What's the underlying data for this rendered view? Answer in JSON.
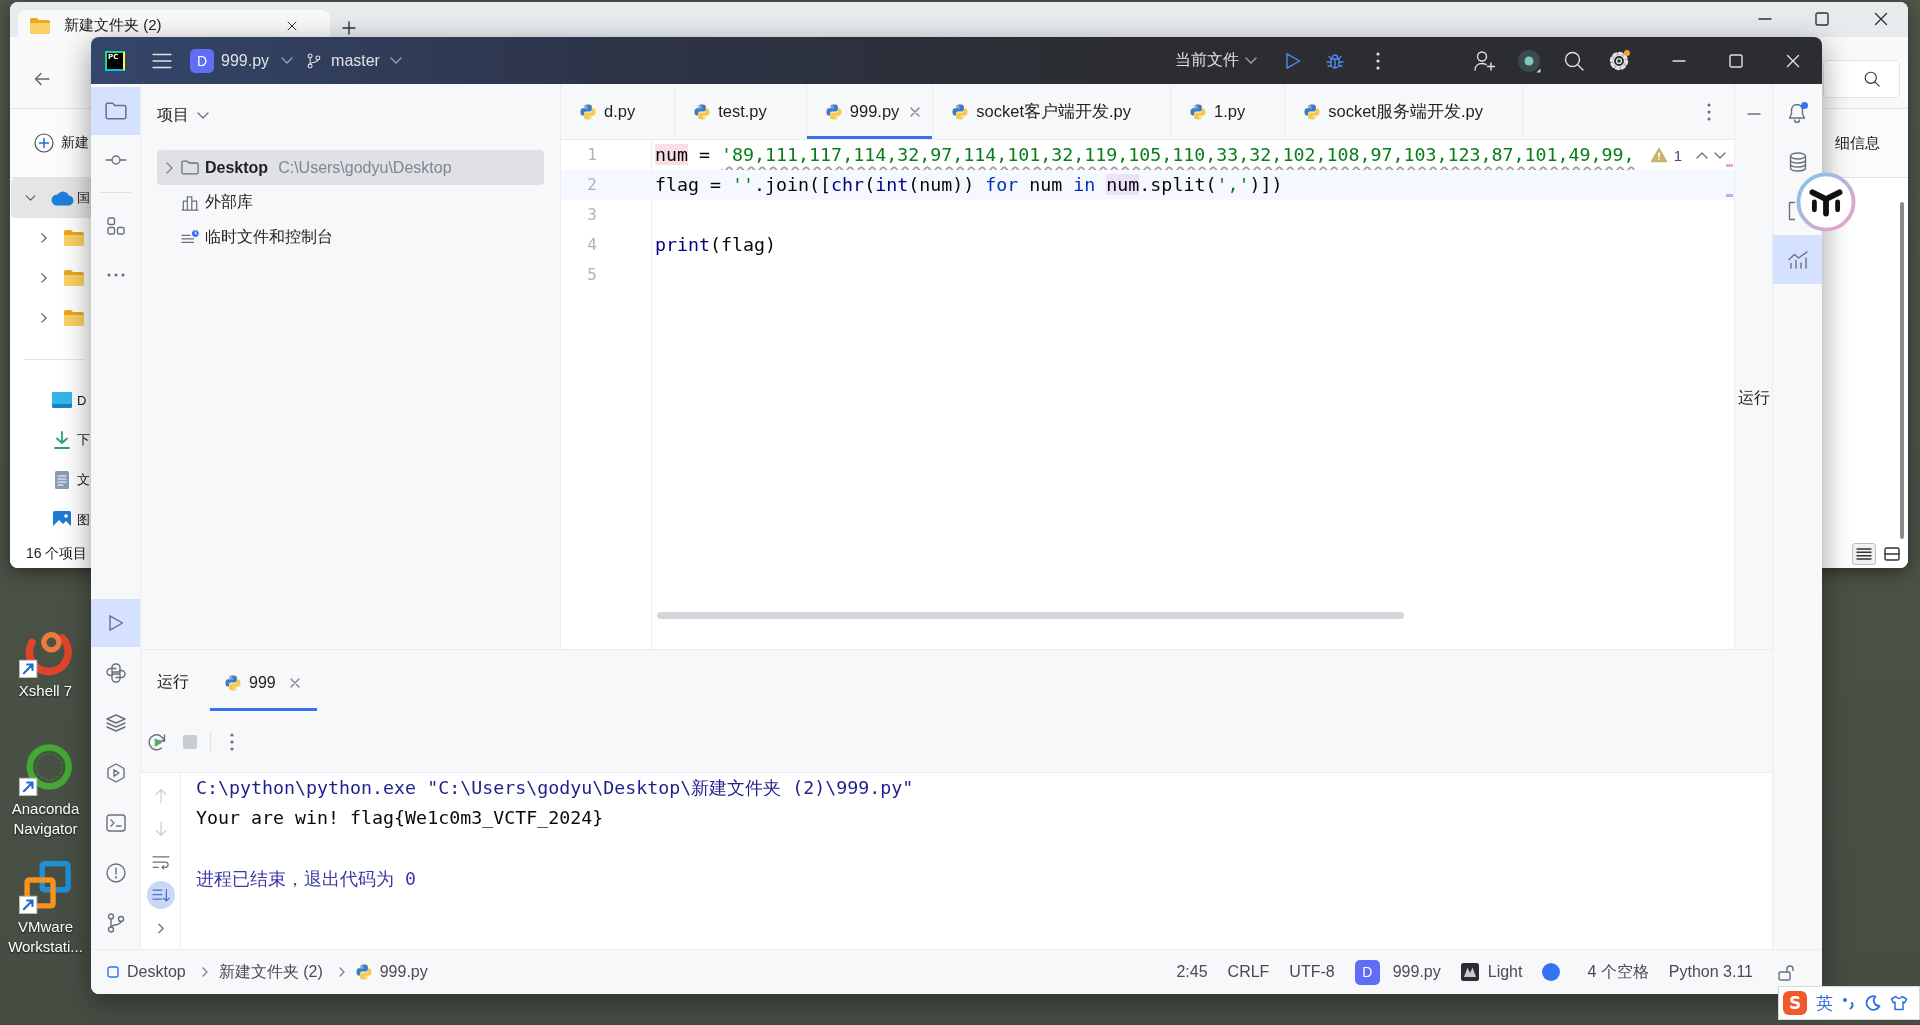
{
  "desktop": {
    "icons": [
      {
        "kind": "xshell",
        "label": "Xshell 7"
      },
      {
        "kind": "anaconda",
        "label": "Anaconda Navigator"
      },
      {
        "kind": "vmware",
        "label": "VMware Workstati..."
      }
    ]
  },
  "file_explorer": {
    "tab": {
      "title": "新建文件夹 (2)"
    },
    "toolbar": {
      "new": "新建",
      "details": "细信息"
    },
    "nav_tree": [
      {
        "kind": "cloud",
        "label": "国",
        "expanded": true,
        "selected": true,
        "children": [
          {
            "kind": "folder",
            "expanded": false,
            "selected": false
          },
          {
            "kind": "folder",
            "expanded": false,
            "selected": false
          },
          {
            "kind": "folder",
            "expanded": false,
            "selected": false
          }
        ]
      }
    ],
    "quick_access": [
      {
        "kind": "desktop",
        "label": "D",
        "selected": false
      },
      {
        "kind": "download",
        "label": "下",
        "selected": false
      },
      {
        "kind": "document",
        "label": "文",
        "selected": false
      },
      {
        "kind": "picture",
        "label": "图",
        "selected": false
      }
    ],
    "status": "16 个项目",
    "views": [
      {
        "kind": "details",
        "selected": true
      },
      {
        "kind": "tiles",
        "selected": false
      }
    ]
  },
  "ide": {
    "title_bar": {
      "app_logo": "PC",
      "project_badge": "D",
      "project": "999.py",
      "branch": "master",
      "run_config": "当前文件",
      "settings_badge": true
    },
    "left_strip": {
      "top": [
        {
          "kind": "project",
          "selected": true
        },
        {
          "kind": "commit",
          "selected": false
        },
        {
          "kind": "structure",
          "selected": false
        },
        {
          "kind": "more",
          "selected": false
        }
      ],
      "bottom": [
        {
          "kind": "run",
          "selected": true
        },
        {
          "kind": "python-console",
          "selected": false
        },
        {
          "kind": "packages",
          "selected": false
        },
        {
          "kind": "services",
          "selected": false
        },
        {
          "kind": "terminal",
          "selected": false
        },
        {
          "kind": "problems",
          "selected": false
        },
        {
          "kind": "git",
          "selected": false
        }
      ]
    },
    "project_panel": {
      "title": "项目",
      "tree": [
        {
          "kind": "folder",
          "label": "Desktop",
          "path": "C:\\Users\\godyu\\Desktop",
          "expanded": false,
          "selected": true
        },
        {
          "kind": "library",
          "label": "外部库",
          "selected": false
        },
        {
          "kind": "scratch",
          "label": "临时文件和控制台",
          "selected": false
        }
      ]
    },
    "editor": {
      "tabs": [
        {
          "label": "d.py",
          "selected": false
        },
        {
          "label": "test.py",
          "selected": false
        },
        {
          "label": "999.py",
          "selected": true
        },
        {
          "label": "socket客户端开发.py",
          "selected": false
        },
        {
          "label": "1.py",
          "selected": false
        },
        {
          "label": "socket服务端开发.py",
          "selected": false
        }
      ],
      "inspection": {
        "warnings": "1"
      },
      "lines": [
        {
          "number": "1",
          "current": false,
          "warning": true,
          "tokens": [
            {
              "kind": "target",
              "text": "num"
            },
            {
              "kind": "plain",
              "text": " = "
            },
            {
              "kind": "string",
              "text": "'89,111,117,114,32,97,114,101,32,119,105,110,33,32,102,108,97,103,123,87,101,49,99,"
            }
          ]
        },
        {
          "number": "2",
          "current": true,
          "warning": false,
          "tokens": [
            {
              "kind": "plain",
              "text": "flag = "
            },
            {
              "kind": "string",
              "text": "''"
            },
            {
              "kind": "plain",
              "text": ".join(["
            },
            {
              "kind": "builtin",
              "text": "chr"
            },
            {
              "kind": "plain",
              "text": "("
            },
            {
              "kind": "builtin",
              "text": "int"
            },
            {
              "kind": "plain",
              "text": "(num)) "
            },
            {
              "kind": "keyword",
              "text": "for"
            },
            {
              "kind": "plain",
              "text": " num "
            },
            {
              "kind": "keyword",
              "text": "in "
            },
            {
              "kind": "reference",
              "text": "num"
            },
            {
              "kind": "plain",
              "text": ".split("
            },
            {
              "kind": "string",
              "text": "','"
            },
            {
              "kind": "plain",
              "text": ")])"
            }
          ]
        },
        {
          "number": "3",
          "current": false
        },
        {
          "number": "4",
          "current": false,
          "warning": false,
          "tokens": [
            {
              "kind": "builtin",
              "text": "print"
            },
            {
              "kind": "plain",
              "text": "(flag)"
            }
          ]
        },
        {
          "number": "5",
          "current": false
        }
      ]
    },
    "side_panel": {
      "label": "运行"
    },
    "right_strip": [
      {
        "kind": "notifications",
        "badge": true,
        "selected": false
      },
      {
        "kind": "database",
        "selected": false
      },
      {
        "kind": "document",
        "selected": false
      },
      {
        "kind": "chart",
        "selected": true
      }
    ],
    "run_panel": {
      "title": "运行",
      "tabs": [
        {
          "label": "999",
          "selected": true
        }
      ],
      "toolbar": [
        {
          "kind": "rerun",
          "disabled": false
        },
        {
          "kind": "stop",
          "disabled": true
        },
        {
          "kind": "more",
          "disabled": false
        }
      ],
      "tools": [
        {
          "kind": "up",
          "disabled": true,
          "selected": false
        },
        {
          "kind": "down",
          "disabled": true,
          "selected": false
        },
        {
          "kind": "soft-wrap",
          "disabled": false,
          "selected": false
        },
        {
          "kind": "scroll-end",
          "disabled": false,
          "selected": true
        },
        {
          "kind": "expand",
          "disabled": false,
          "selected": false
        }
      ],
      "console": [
        {
          "kind": "command",
          "text": "C:\\python\\python.exe \"C:\\Users\\godyu\\Desktop\\新建文件夹 (2)\\999.py\""
        },
        {
          "kind": "output",
          "text": "Your are win! flag{We1c0m3_VCTF_2024}"
        },
        {
          "kind": "system",
          "text": "进程已结束，退出代码为 0"
        }
      ]
    },
    "status_bar": {
      "breadcrumb": [
        {
          "kind": "module",
          "label": "Desktop"
        },
        {
          "kind": "folder",
          "label": "新建文件夹 (2)"
        },
        {
          "kind": "python",
          "label": "999.py"
        }
      ],
      "position": "2:45",
      "line_separator": "CRLF",
      "encoding": "UTF-8",
      "project_badge": "D",
      "project": "999.py",
      "theme": "Light",
      "indent": "4 个空格",
      "interpreter": "Python 3.11"
    }
  },
  "ime_bar": {
    "logo": "S",
    "mode": "英"
  }
}
